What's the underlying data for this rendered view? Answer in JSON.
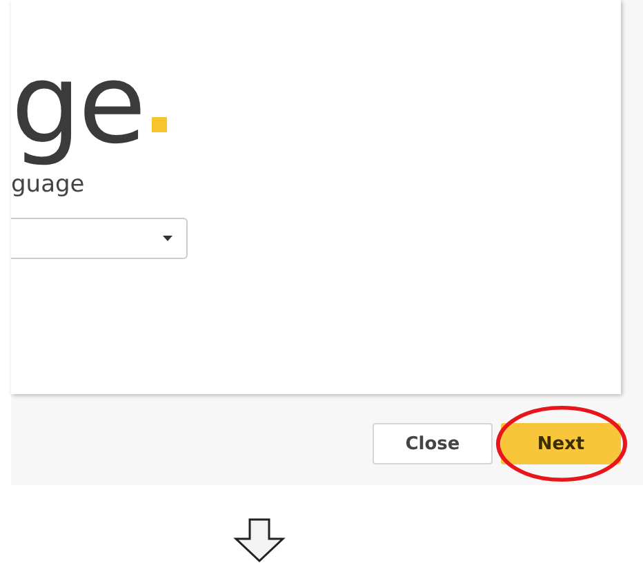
{
  "heading": "ge",
  "field_label": "guage",
  "buttons": [
    {
      "label": "Close",
      "kind": "secondary",
      "highlighted": false
    },
    {
      "label": "Next",
      "kind": "primary",
      "highlighted": true
    }
  ]
}
